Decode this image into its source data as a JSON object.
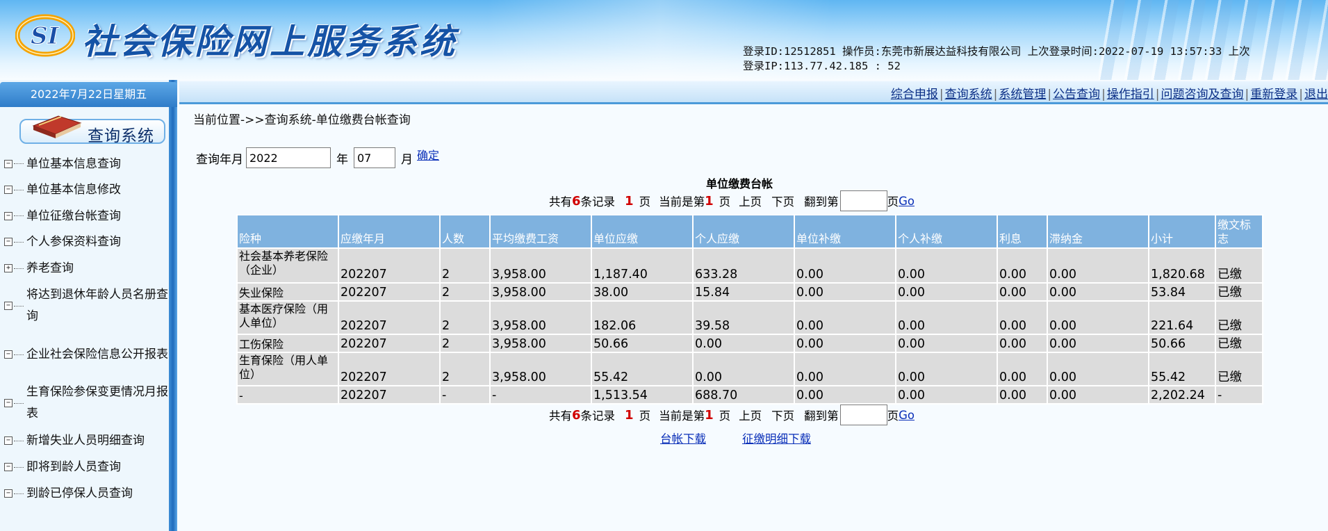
{
  "header": {
    "title": "社会保险网上服务系统",
    "logo_text": "SI",
    "login_line1": "登录ID:12512851  操作员:东莞市新展达益科技有限公司  上次登录时间:2022-07-19 13:57:33  上次",
    "login_line2": "登录IP:113.77.42.185 :  52"
  },
  "sidebar": {
    "date": "2022年7月22日星期五",
    "menu_title": "查询系统",
    "items": [
      {
        "label": "单位基本信息查询",
        "toggle": "−"
      },
      {
        "label": "单位基本信息修改",
        "toggle": "−"
      },
      {
        "label": "单位征缴台帐查询",
        "toggle": "−"
      },
      {
        "label": "个人参保资料查询",
        "toggle": "−"
      },
      {
        "label": "养老查询",
        "toggle": "+"
      },
      {
        "label": "将达到退休年龄人员名册查询",
        "toggle": "−"
      },
      {
        "label": "企业社会保险信息公开报表",
        "toggle": "−"
      },
      {
        "label": "生育保险参保变更情况月报表",
        "toggle": "−"
      },
      {
        "label": "新增失业人员明细查询",
        "toggle": "−"
      },
      {
        "label": "即将到龄人员查询",
        "toggle": "−"
      },
      {
        "label": "到龄已停保人员查询",
        "toggle": "−"
      }
    ]
  },
  "nav": {
    "links": [
      "综合申报",
      "查询系统",
      "系统管理",
      "公告查询",
      "操作指引",
      "问题咨询及查询",
      "重新登录",
      "退出"
    ]
  },
  "main": {
    "breadcrumb": "当前位置->>查询系统-单位缴费台帐查询",
    "query": {
      "label": "查询年月",
      "year_value": "2022",
      "year_unit": "年",
      "month_value": "07",
      "month_unit": "月",
      "confirm": "确定"
    },
    "ledger_title": "单位缴费台帐",
    "pager": {
      "total_prefix": "共有",
      "total_count": "6",
      "total_suffix": "条记录",
      "pages": "1",
      "pages_unit": "页",
      "current_prefix": "当前是第",
      "current_page": "1",
      "current_unit": "页",
      "prev": "上页",
      "next": "下页",
      "goto_prefix": "翻到第",
      "goto_unit": "页",
      "go": "Go"
    },
    "table": {
      "headers": [
        "险种",
        "应缴年月",
        "人数",
        "平均缴费工资",
        "单位应缴",
        "个人应缴",
        "单位补缴",
        "个人补缴",
        "利息",
        "滞纳金",
        "小计",
        "缴文标志"
      ],
      "rows": [
        [
          "社会基本养老保险（企业）",
          "202207",
          "2",
          "3,958.00",
          "1,187.40",
          "633.28",
          "0.00",
          "0.00",
          "0.00",
          "0.00",
          "1,820.68",
          "已缴"
        ],
        [
          "失业保险",
          "202207",
          "2",
          "3,958.00",
          "38.00",
          "15.84",
          "0.00",
          "0.00",
          "0.00",
          "0.00",
          "53.84",
          "已缴"
        ],
        [
          "基本医疗保险（用人单位）",
          "202207",
          "2",
          "3,958.00",
          "182.06",
          "39.58",
          "0.00",
          "0.00",
          "0.00",
          "0.00",
          "221.64",
          "已缴"
        ],
        [
          "工伤保险",
          "202207",
          "2",
          "3,958.00",
          "50.66",
          "0.00",
          "0.00",
          "0.00",
          "0.00",
          "0.00",
          "50.66",
          "已缴"
        ],
        [
          "生育保险（用人单位）",
          "202207",
          "2",
          "3,958.00",
          "55.42",
          "0.00",
          "0.00",
          "0.00",
          "0.00",
          "0.00",
          "55.42",
          "已缴"
        ],
        [
          "-",
          "202207",
          "-",
          "-",
          "1,513.54",
          "688.70",
          "0.00",
          "0.00",
          "0.00",
          "0.00",
          "2,202.24",
          "-"
        ]
      ]
    },
    "downloads": {
      "ledger": "台帐下载",
      "detail": "征缴明细下载"
    }
  },
  "colors": {
    "header_blue": "#5fb6f2",
    "title_blue": "#1553a6",
    "table_header": "#7fb2df",
    "table_cell": "#dcdcdc",
    "link": "#0a2fb8",
    "count_red": "#d10000"
  }
}
